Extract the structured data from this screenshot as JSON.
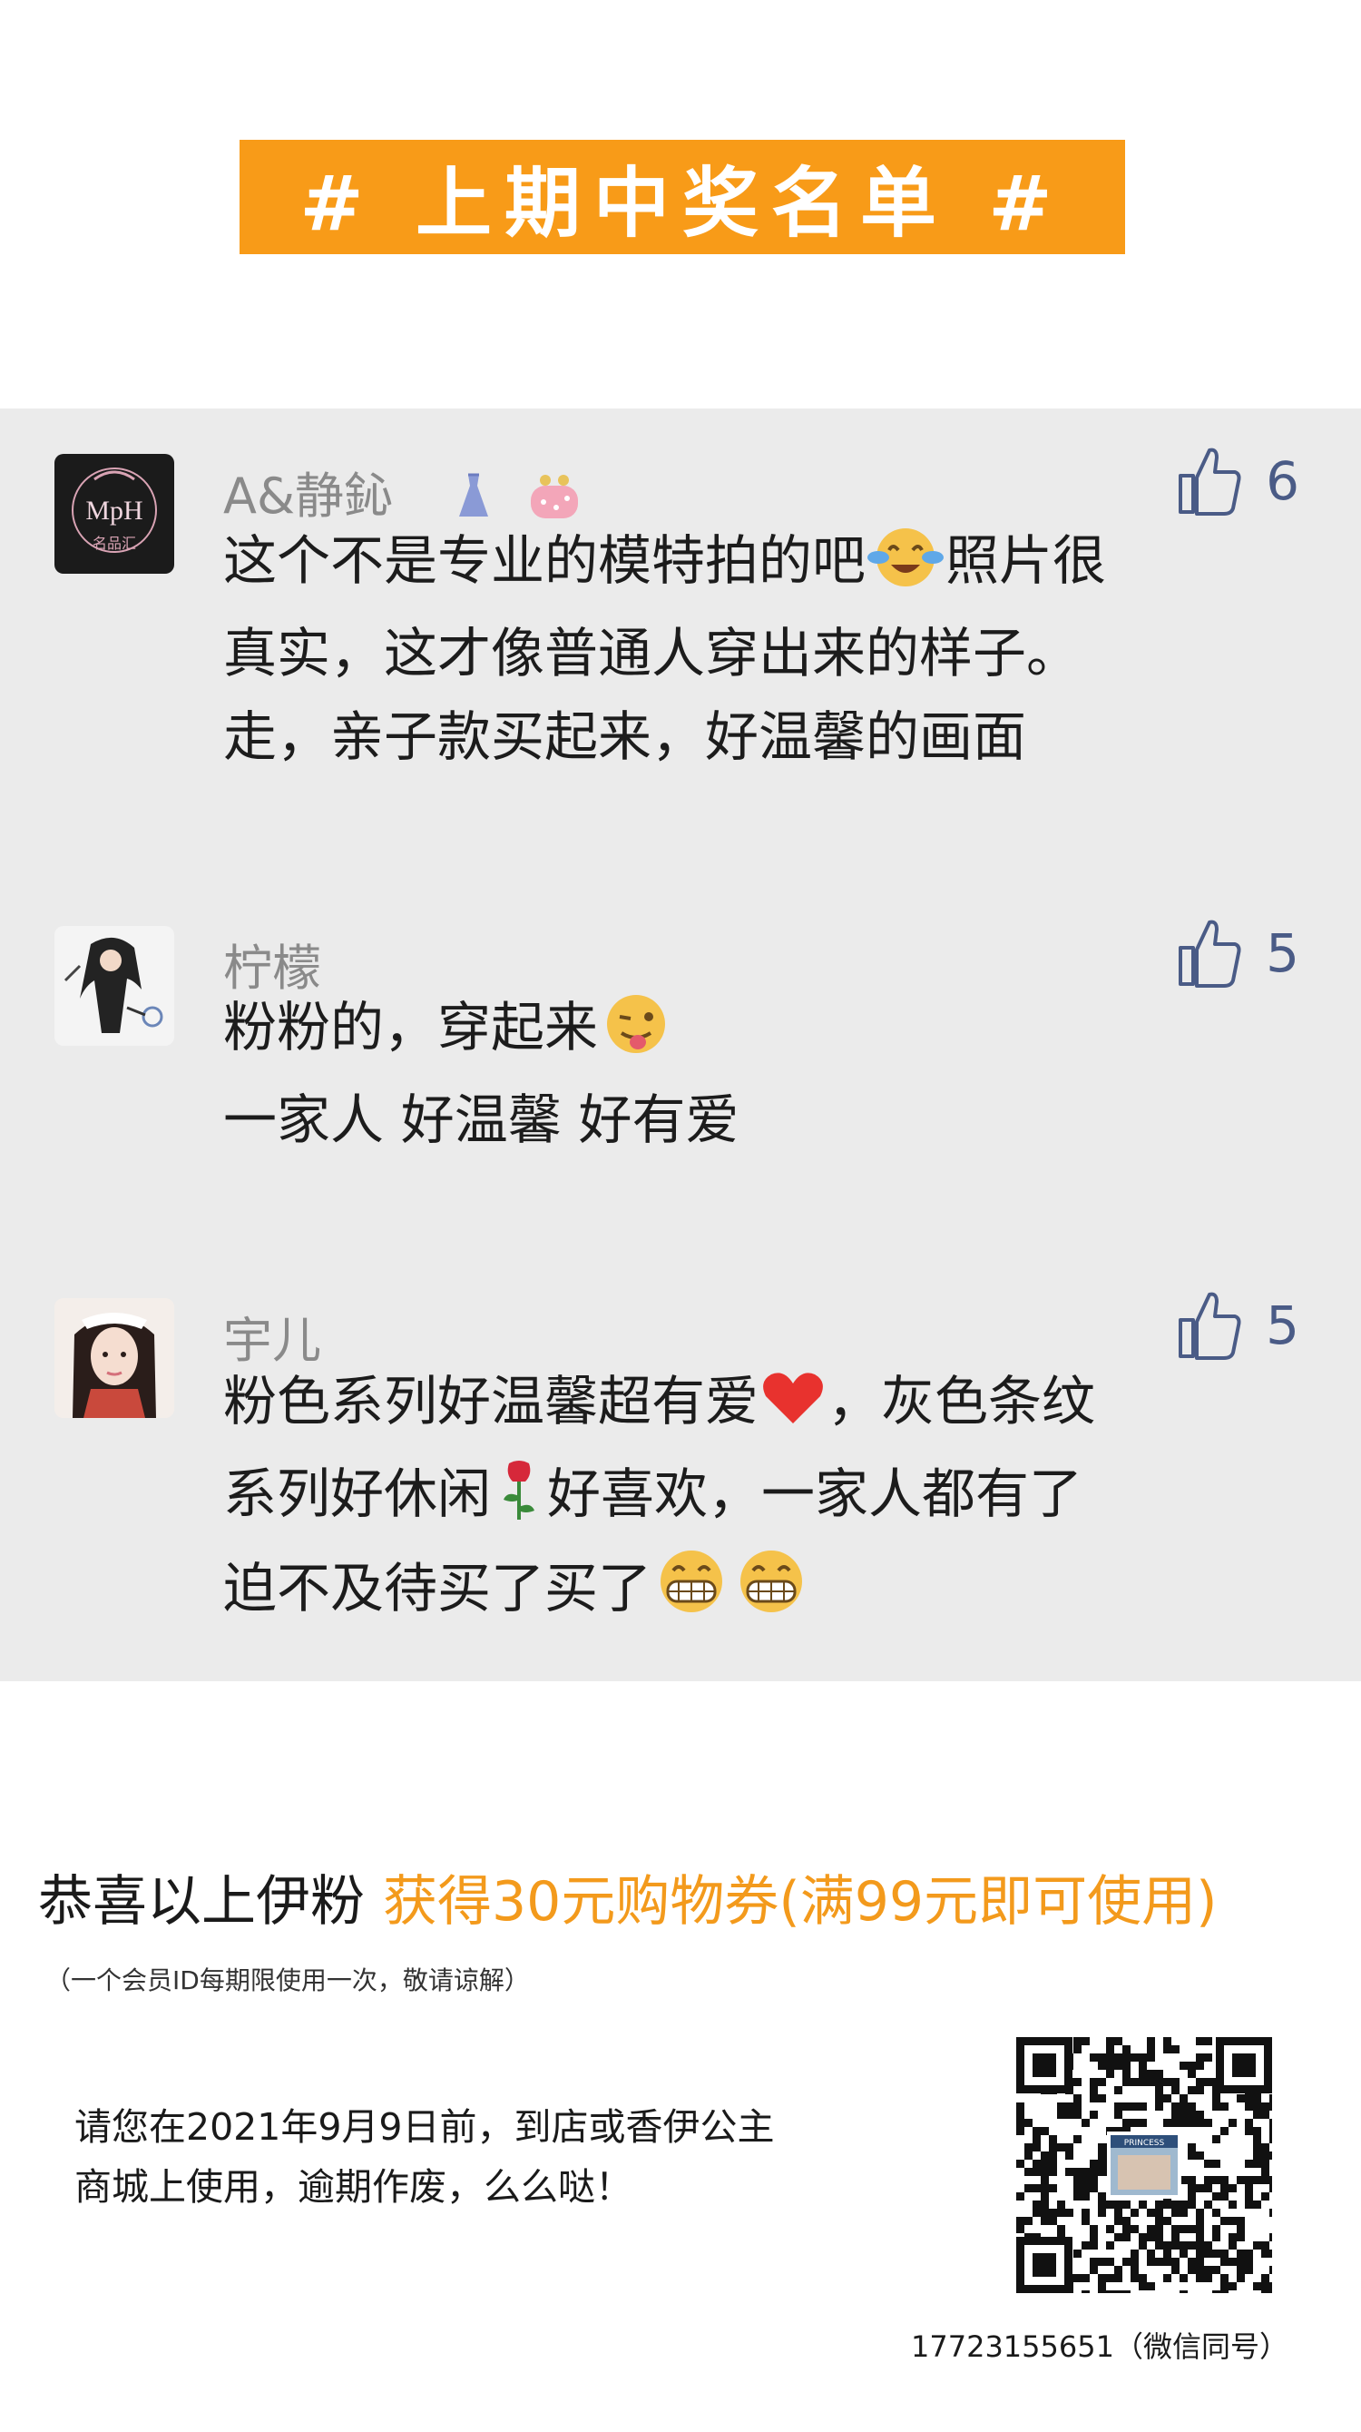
{
  "banner": {
    "title": "# 上期中奖名单 #"
  },
  "comments": [
    {
      "user": "A&静鈊",
      "likes": "6",
      "avatar_text_top": "MpH",
      "avatar_text_bottom": "名品汇",
      "lines": [
        "这个不是专业的模特拍的吧",
        "照片很",
        "真实，这才像普通人穿出来的样子。",
        "走，亲子款买起来，好温馨的画面"
      ]
    },
    {
      "user": "柠檬",
      "likes": "5",
      "lines": [
        "粉粉的，穿起来",
        "一家人 好温馨 好有爱"
      ]
    },
    {
      "user": "宇儿",
      "likes": "5",
      "lines": [
        "粉色系列好温馨超有爱",
        "，灰色条纹",
        "系列好休闲",
        "好喜欢，一家人都有了",
        "迫不及待买了买了"
      ]
    }
  ],
  "congrats": {
    "lead": "恭喜以上伊粉",
    "prize": "获得30元购物券(满99元即可使用)"
  },
  "note": "（一个会员ID每期限使用一次，敬请谅解）",
  "instruction": {
    "line1": "请您在2021年9月9日前，到店或香伊公主",
    "line2": "商城上使用，逾期作废，么么哒！"
  },
  "qr": {
    "caption": "PRINCESS"
  },
  "contact": {
    "phone": "17723155651（微信同号）"
  },
  "colors": {
    "accent": "#f89b18",
    "panel": "#ebebeb",
    "like": "#4a5b86"
  }
}
